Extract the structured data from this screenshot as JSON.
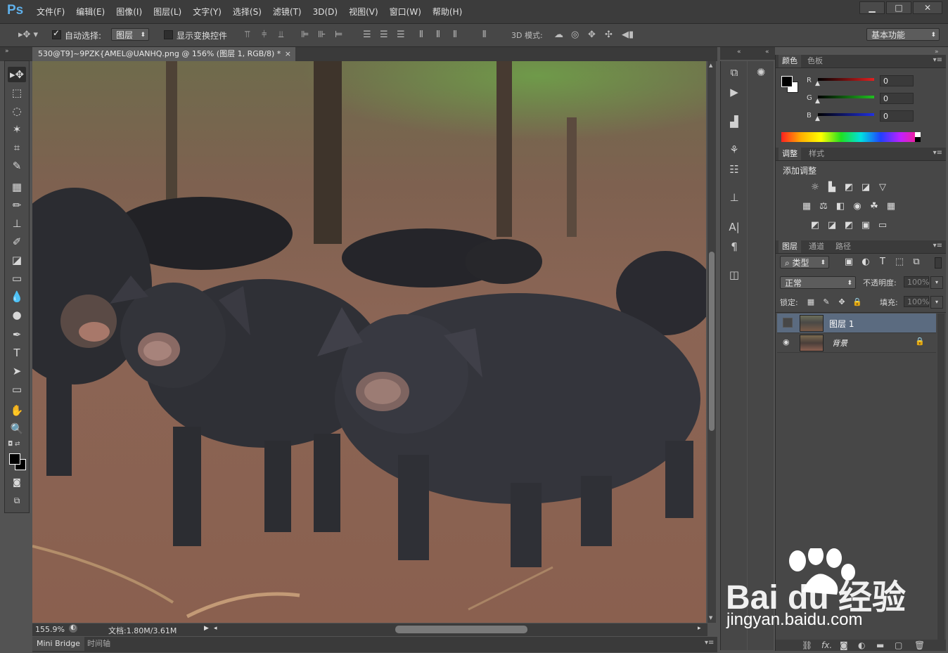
{
  "app": {
    "logo": "Ps"
  },
  "menu": [
    "文件(F)",
    "编辑(E)",
    "图像(I)",
    "图层(L)",
    "文字(Y)",
    "选择(S)",
    "滤镜(T)",
    "3D(D)",
    "视图(V)",
    "窗口(W)",
    "帮助(H)"
  ],
  "window_controls": {
    "minimize": "▁",
    "maximize": "□",
    "close": "✕"
  },
  "options": {
    "auto_select_label": "自动选择:",
    "auto_select_checked": true,
    "auto_select_target": "图层",
    "show_transform_label": "显示变换控件",
    "mode3d_label": "3D 模式:",
    "workspace": "基本功能"
  },
  "document": {
    "tab_title": "530@T9]~9PZK{AMEL@UANHQ.png @ 156% (图层 1, RGB/8) *",
    "zoom": "155.9%",
    "doc_info": "文档:1.80M/3.61M"
  },
  "bottom_tabs": [
    "Mini Bridge",
    "时间轴"
  ],
  "color_panel": {
    "tabs": [
      "颜色",
      "色板"
    ],
    "channels": [
      {
        "label": "R",
        "value": "0",
        "color": "#e02020"
      },
      {
        "label": "G",
        "value": "0",
        "color": "#20c020"
      },
      {
        "label": "B",
        "value": "0",
        "color": "#2030e0"
      }
    ],
    "foreground": "#000000",
    "background": "#ffffff"
  },
  "adjust_panel": {
    "tabs": [
      "调整",
      "样式"
    ],
    "title": "添加调整"
  },
  "layers_panel": {
    "tabs": [
      "图层",
      "通道",
      "路径"
    ],
    "filter_label": "类型",
    "blend_mode": "正常",
    "opacity_label": "不透明度:",
    "opacity": "100%",
    "lock_label": "锁定:",
    "fill_label": "填充:",
    "fill": "100%",
    "layers": [
      {
        "name": "图层 1",
        "visible": false,
        "selected": true
      },
      {
        "name": "背景",
        "visible": true,
        "selected": false,
        "locked": true
      }
    ]
  },
  "watermark": {
    "brand": "Bai du 经验",
    "url": "jingyan.baidu.com"
  },
  "icons": {
    "eye": "eye-icon",
    "lock": "lock-icon"
  }
}
